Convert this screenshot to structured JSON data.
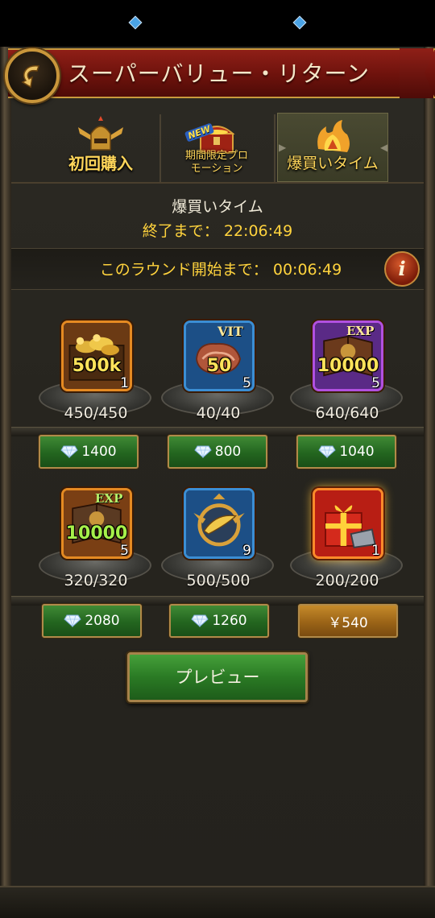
{
  "header": {
    "title": "スーパーバリュー・リターン",
    "back_icon": "back-arrow-icon"
  },
  "tabs": [
    {
      "label": "初回購入",
      "icon": "winged-helmet-icon",
      "active": false
    },
    {
      "label": "期間限定プロモーション",
      "label_line1": "期間限定プロ",
      "label_line2": "モーション",
      "badge": "NEW",
      "icon": "treasure-chest-icon",
      "active": false
    },
    {
      "label": "爆買いタイム",
      "icon": "flaming-crest-icon",
      "active": true
    }
  ],
  "event": {
    "name": "爆買いタイム",
    "end_label": "終了まで：",
    "end_time": "22:06:49",
    "round_label": "このラウンド開始まで：",
    "round_time": "00:06:49"
  },
  "info_button": {
    "label": "i"
  },
  "items": [
    {
      "icon": "gold-coins-chest-icon",
      "amount": "500k",
      "qty": "1",
      "stock": "450/450",
      "price": "1400",
      "currency": "diamond-icon"
    },
    {
      "icon": "meat-vit-icon",
      "badge": "VIT",
      "amount": "50",
      "qty": "5",
      "stock": "40/40",
      "price": "800",
      "currency": "diamond-icon"
    },
    {
      "icon": "exp-book-purple-icon",
      "badge": "EXP",
      "amount": "10000",
      "qty": "5",
      "stock": "640/640",
      "price": "1040",
      "currency": "diamond-icon"
    },
    {
      "icon": "exp-book-green-icon",
      "badge": "EXP",
      "amount": "10000",
      "qty": "5",
      "stock": "320/320",
      "price": "2080",
      "currency": "diamond-icon"
    },
    {
      "icon": "golden-horn-emblem-icon",
      "amount": "",
      "qty": "9",
      "stock": "500/500",
      "price": "1260",
      "currency": "diamond-icon"
    },
    {
      "icon": "gift-box-icon",
      "amount": "",
      "qty": "1",
      "stock": "200/200",
      "price": "￥540",
      "currency": "yen"
    }
  ],
  "preview_button": {
    "label": "プレビュー"
  },
  "colors": {
    "accent_gold": "#ffd33d",
    "header_red": "#8f1f17",
    "button_green": "#2a7a24"
  }
}
